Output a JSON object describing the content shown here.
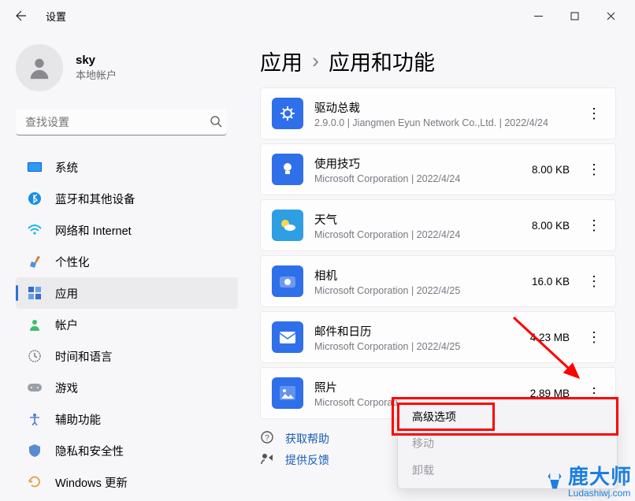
{
  "window": {
    "title": "设置",
    "user_name": "sky",
    "user_sub": "本地帐户",
    "search_placeholder": "查找设置"
  },
  "nav": {
    "items": [
      {
        "label": "系统"
      },
      {
        "label": "蓝牙和其他设备"
      },
      {
        "label": "网络和 Internet"
      },
      {
        "label": "个性化"
      },
      {
        "label": "应用"
      },
      {
        "label": "帐户"
      },
      {
        "label": "时间和语言"
      },
      {
        "label": "游戏"
      },
      {
        "label": "辅助功能"
      },
      {
        "label": "隐私和安全性"
      },
      {
        "label": "Windows 更新"
      }
    ]
  },
  "breadcrumb": {
    "root": "应用",
    "leaf": "应用和功能"
  },
  "apps": [
    {
      "name": "驱动总裁",
      "meta": "2.9.0.0   |   Jiangmen Eyun Network Co.,Ltd.   |   2022/4/24",
      "size": ""
    },
    {
      "name": "使用技巧",
      "meta": "Microsoft Corporation   |   2022/4/24",
      "size": "8.00 KB"
    },
    {
      "name": "天气",
      "meta": "Microsoft Corporation   |   2022/4/24",
      "size": "8.00 KB"
    },
    {
      "name": "相机",
      "meta": "Microsoft Corporation   |   2022/4/25",
      "size": "16.0 KB"
    },
    {
      "name": "邮件和日历",
      "meta": "Microsoft Corporation   |   2022/4/25",
      "size": "4.23 MB"
    },
    {
      "name": "照片",
      "meta": "Microsoft Corporation   |   2022/4/24",
      "size": "2.89 MB"
    }
  ],
  "popup": {
    "advanced": "高级选项",
    "move": "移动",
    "uninstall": "卸载"
  },
  "help": {
    "get_help": "获取帮助",
    "feedback": "提供反馈"
  },
  "watermark": {
    "big": "鹿大师",
    "small": "Ludashiwj.com"
  }
}
